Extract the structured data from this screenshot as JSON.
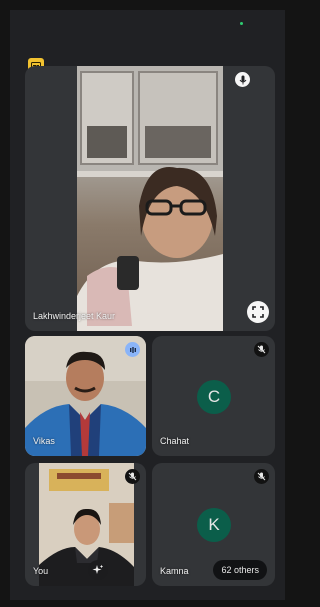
{
  "status_indicator": {
    "color": "#2ecc71"
  },
  "app_badge": {
    "icon": "caption-icon",
    "color": "#f2c230"
  },
  "participants": {
    "main": {
      "name": "Lakhwinderjeet Kaur",
      "icon_top": "microphone-icon",
      "icon_bottom": "fullscreen-icon"
    },
    "vikas": {
      "name": "Vikas",
      "status_icon": "audio-level-icon"
    },
    "chahat": {
      "name": "Chahat",
      "initial": "C",
      "status_icon": "mic-off-icon"
    },
    "you": {
      "name": "You",
      "status_icon": "mic-off-icon",
      "effects_icon": "sparkle-icon"
    },
    "kamna": {
      "name": "Kamna",
      "initial": "K",
      "status_icon": "mic-off-icon",
      "others_label": "62 others"
    }
  },
  "colors": {
    "tile_bg": "#333538",
    "avatar_bg": "#0b5e4a",
    "accent_blue": "#8ab4f8"
  }
}
